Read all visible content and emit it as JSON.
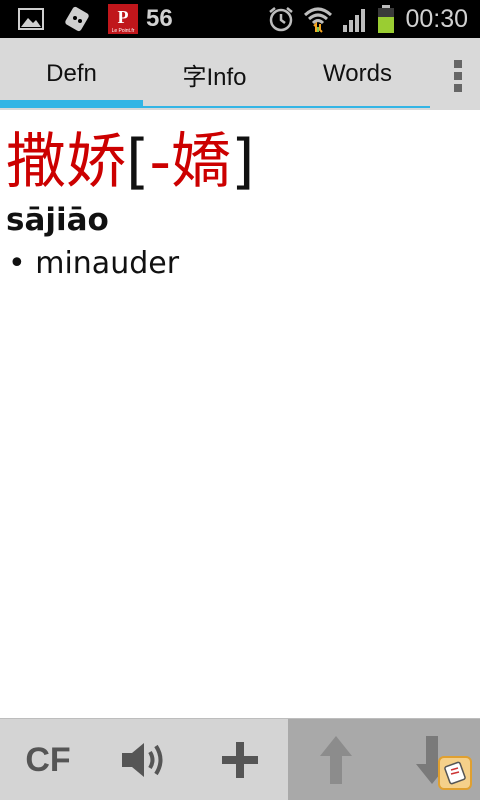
{
  "status_bar": {
    "notification_count": "56",
    "time": "00:30",
    "icons": [
      "gallery-icon",
      "game-icon",
      "app-notification-icon",
      "alarm-icon",
      "wifi-icon",
      "signal-icon",
      "battery-icon"
    ]
  },
  "tabs": [
    {
      "label": "Defn",
      "selected": true
    },
    {
      "label": "字Info",
      "selected": false
    },
    {
      "label": "Words",
      "selected": false
    }
  ],
  "entry": {
    "simplified": "撒娇",
    "bracket_open": "[",
    "traditional": "-嬌",
    "bracket_close": "]",
    "pinyin": "sājiāo",
    "definition": "• minauder"
  },
  "toolbar": {
    "cf_label": "CF",
    "buttons": [
      "cf-button",
      "sound-button",
      "add-button",
      "up-button",
      "down-button"
    ]
  },
  "colors": {
    "accent": "#33b5e5",
    "headword_red": "#cc0000",
    "tab_bg": "#d9d9d9",
    "toolbar_bg": "#d4d4d4",
    "nav_bg": "#a9a9a9"
  }
}
